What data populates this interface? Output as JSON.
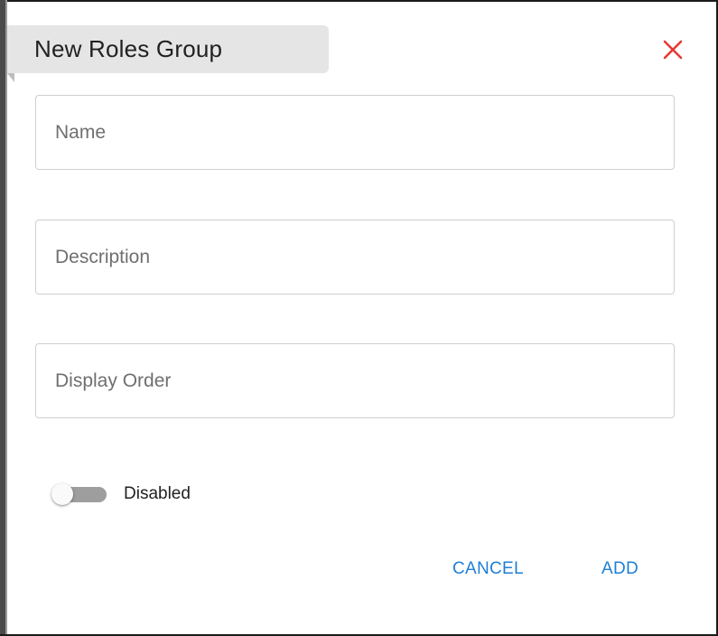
{
  "dialog": {
    "title": "New Roles Group",
    "close_icon": "close-icon",
    "accent_color": "#1e7fd6",
    "close_color": "#e53935"
  },
  "form": {
    "name": {
      "placeholder": "Name",
      "value": ""
    },
    "description": {
      "placeholder": "Description",
      "value": ""
    },
    "display_order": {
      "placeholder": "Display Order",
      "value": ""
    },
    "status_toggle": {
      "label": "Disabled",
      "checked": false
    }
  },
  "actions": {
    "cancel_label": "CANCEL",
    "add_label": "ADD"
  }
}
